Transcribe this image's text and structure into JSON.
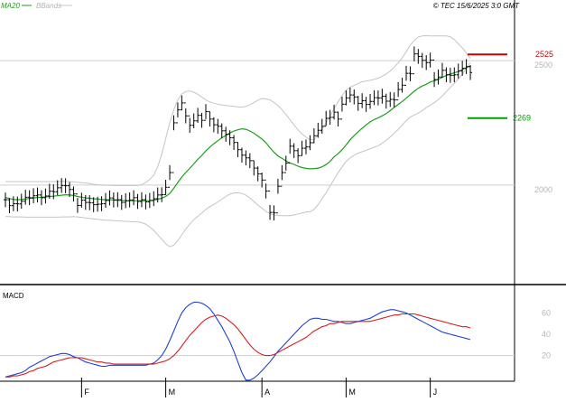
{
  "header": {
    "legend_ma": "MA20",
    "legend_bb": "BBands",
    "copyright": "© TEC 15/6/2025 3:0 GMT"
  },
  "colors": {
    "ma": "#1aa01a",
    "bands": "#c4c4c4",
    "price": "#000000",
    "macd_line": "#1f3fd0",
    "signal_line": "#d21f1f",
    "resistance": "#cc0000",
    "support": "#00a000",
    "grid": "#cfcfcf",
    "axis": "#000000"
  },
  "chart_data": [
    {
      "type": "ohlc",
      "panel": "price",
      "ylim": [
        1600,
        2700
      ],
      "y_ticks": [
        {
          "value": 2000,
          "label": "2000"
        },
        {
          "value": 2500,
          "label": "2500"
        }
      ],
      "gridlines": [
        2000,
        2500
      ],
      "levels": [
        {
          "name": "resistance",
          "value": 2525,
          "label": "2525"
        },
        {
          "name": "support",
          "value": 2269,
          "label": "2269"
        }
      ],
      "x_ticks": [
        {
          "index": 19,
          "label": "F"
        },
        {
          "index": 40,
          "label": "M"
        },
        {
          "index": 64,
          "label": "A"
        },
        {
          "index": 85,
          "label": "M"
        },
        {
          "index": 106,
          "label": "J"
        }
      ],
      "n_bars": 117,
      "close": [
        1941,
        1917,
        1925,
        1924,
        1935,
        1951,
        1949,
        1957,
        1960,
        1949,
        1956,
        1975,
        1973,
        1989,
        1998,
        1997,
        1982,
        1964,
        1918,
        1939,
        1930,
        1929,
        1921,
        1923,
        1925,
        1938,
        1948,
        1940,
        1941,
        1930,
        1937,
        1940,
        1949,
        1934,
        1941,
        1932,
        1938,
        1945,
        1960,
        1961,
        1991,
        2050,
        2250,
        2302,
        2330,
        2278,
        2240,
        2258,
        2280,
        2260,
        2295,
        2265,
        2242,
        2236,
        2218,
        2204,
        2190,
        2171,
        2142,
        2120,
        2109,
        2098,
        2068,
        2045,
        2020,
        1976,
        1890,
        1888,
        1995,
        2050,
        2088,
        2156,
        2138,
        2118,
        2148,
        2153,
        2170,
        2198,
        2220,
        2236,
        2268,
        2272,
        2293,
        2265,
        2325,
        2350,
        2362,
        2354,
        2328,
        2339,
        2324,
        2336,
        2351,
        2350,
        2357,
        2337,
        2344,
        2342,
        2384,
        2401,
        2449,
        2447,
        2527,
        2517,
        2501,
        2492,
        2502,
        2424,
        2434,
        2461,
        2443,
        2441,
        2443,
        2458,
        2469,
        2476,
        2452
      ],
      "ma20": [
        1950,
        1946,
        1942,
        1941,
        1942,
        1944,
        1946,
        1948,
        1950,
        1951,
        1952,
        1954,
        1955,
        1957,
        1959,
        1961,
        1960,
        1958,
        1954,
        1951,
        1948,
        1947,
        1945,
        1944,
        1942,
        1941,
        1941,
        1940,
        1939,
        1938,
        1937,
        1937,
        1937,
        1937,
        1937,
        1937,
        1937,
        1939,
        1943,
        1947,
        1954,
        1966,
        1987,
        2010,
        2032,
        2050,
        2067,
        2085,
        2103,
        2119,
        2137,
        2152,
        2166,
        2178,
        2190,
        2199,
        2209,
        2217,
        2222,
        2226,
        2224,
        2217,
        2208,
        2197,
        2185,
        2170,
        2150,
        2132,
        2117,
        2107,
        2097,
        2089,
        2083,
        2076,
        2070,
        2067,
        2065,
        2066,
        2068,
        2073,
        2082,
        2095,
        2113,
        2126,
        2142,
        2161,
        2182,
        2199,
        2214,
        2228,
        2242,
        2254,
        2263,
        2270,
        2278,
        2287,
        2299,
        2312,
        2324,
        2336,
        2349,
        2363,
        2377,
        2389,
        2398,
        2405,
        2414,
        2419,
        2425,
        2433,
        2440,
        2446,
        2451,
        2456,
        2464,
        2472,
        2478
      ],
      "bb_upper": [
        2014,
        2014,
        2014,
        2014,
        2014,
        2014,
        2014,
        2014,
        2014,
        2014,
        2014,
        2014,
        2014,
        2014,
        2015,
        2014,
        2014,
        2013,
        2011,
        2010,
        2008,
        2006,
        2003,
        2001,
        2000,
        1999,
        1999,
        1998,
        1998,
        1998,
        1998,
        1998,
        1998,
        1998,
        2002,
        2010,
        2022,
        2040,
        2073,
        2124,
        2187,
        2250,
        2302,
        2342,
        2366,
        2376,
        2378,
        2373,
        2365,
        2353,
        2342,
        2334,
        2329,
        2325,
        2322,
        2320,
        2318,
        2316,
        2314,
        2313,
        2316,
        2322,
        2331,
        2341,
        2348,
        2346,
        2342,
        2332,
        2319,
        2303,
        2283,
        2263,
        2242,
        2222,
        2205,
        2192,
        2182,
        2183,
        2202,
        2225,
        2249,
        2278,
        2306,
        2334,
        2360,
        2381,
        2393,
        2401,
        2408,
        2415,
        2418,
        2421,
        2425,
        2429,
        2437,
        2446,
        2458,
        2474,
        2491,
        2512,
        2536,
        2562,
        2581,
        2595,
        2599,
        2600,
        2599,
        2599,
        2599,
        2599,
        2599,
        2596,
        2585,
        2568,
        2551,
        2530,
        2509
      ],
      "bb_lower": [
        1873,
        1873,
        1872,
        1872,
        1872,
        1871,
        1871,
        1871,
        1871,
        1871,
        1871,
        1871,
        1871,
        1871,
        1872,
        1872,
        1872,
        1873,
        1872,
        1870,
        1868,
        1866,
        1864,
        1862,
        1860,
        1859,
        1858,
        1857,
        1856,
        1855,
        1854,
        1853,
        1852,
        1852,
        1849,
        1843,
        1832,
        1818,
        1800,
        1782,
        1764,
        1752,
        1758,
        1776,
        1800,
        1823,
        1843,
        1861,
        1874,
        1887,
        1902,
        1913,
        1922,
        1932,
        1943,
        1954,
        1963,
        1968,
        1969,
        1966,
        1959,
        1948,
        1934,
        1919,
        1907,
        1894,
        1885,
        1880,
        1878,
        1877,
        1877,
        1877,
        1880,
        1884,
        1888,
        1891,
        1893,
        1902,
        1921,
        1945,
        1969,
        1996,
        2023,
        2049,
        2073,
        2095,
        2109,
        2120,
        2128,
        2134,
        2139,
        2146,
        2152,
        2158,
        2168,
        2180,
        2193,
        2208,
        2223,
        2241,
        2259,
        2273,
        2281,
        2289,
        2299,
        2311,
        2321,
        2331,
        2343,
        2358,
        2375,
        2392,
        2408,
        2426,
        2444,
        2469,
        2492
      ],
      "high": [
        1970,
        1947,
        1955,
        1954,
        1965,
        1981,
        1979,
        1987,
        1990,
        1979,
        1986,
        2005,
        2003,
        2019,
        2028,
        2027,
        2012,
        1994,
        1948,
        1969,
        1960,
        1959,
        1951,
        1953,
        1955,
        1968,
        1978,
        1970,
        1971,
        1960,
        1967,
        1970,
        1979,
        1964,
        1971,
        1962,
        1968,
        1975,
        1990,
        1991,
        2021,
        2080,
        2280,
        2332,
        2360,
        2308,
        2270,
        2288,
        2310,
        2290,
        2325,
        2295,
        2272,
        2266,
        2248,
        2234,
        2220,
        2201,
        2172,
        2150,
        2139,
        2128,
        2098,
        2075,
        2050,
        2006,
        1920,
        1918,
        2025,
        2080,
        2118,
        2186,
        2168,
        2148,
        2178,
        2183,
        2200,
        2228,
        2250,
        2266,
        2298,
        2302,
        2323,
        2295,
        2355,
        2380,
        2392,
        2384,
        2358,
        2369,
        2354,
        2366,
        2381,
        2380,
        2387,
        2367,
        2374,
        2372,
        2414,
        2431,
        2479,
        2477,
        2557,
        2547,
        2531,
        2522,
        2532,
        2454,
        2464,
        2491,
        2473,
        2471,
        2473,
        2488,
        2499,
        2506,
        2482
      ],
      "low": [
        1911,
        1887,
        1895,
        1894,
        1905,
        1921,
        1919,
        1927,
        1930,
        1919,
        1926,
        1945,
        1943,
        1959,
        1968,
        1967,
        1952,
        1934,
        1888,
        1909,
        1900,
        1899,
        1891,
        1893,
        1895,
        1908,
        1918,
        1910,
        1911,
        1900,
        1907,
        1910,
        1919,
        1904,
        1911,
        1902,
        1908,
        1915,
        1930,
        1931,
        1961,
        2020,
        2220,
        2272,
        2300,
        2248,
        2210,
        2228,
        2250,
        2230,
        2265,
        2235,
        2212,
        2206,
        2188,
        2174,
        2160,
        2141,
        2112,
        2090,
        2079,
        2068,
        2038,
        2015,
        1990,
        1946,
        1860,
        1858,
        1965,
        2020,
        2058,
        2126,
        2108,
        2088,
        2118,
        2123,
        2140,
        2168,
        2190,
        2206,
        2238,
        2242,
        2263,
        2235,
        2295,
        2320,
        2332,
        2324,
        2298,
        2309,
        2294,
        2306,
        2321,
        2320,
        2327,
        2307,
        2314,
        2312,
        2354,
        2371,
        2419,
        2417,
        2497,
        2487,
        2471,
        2462,
        2472,
        2394,
        2404,
        2431,
        2413,
        2411,
        2413,
        2428,
        2439,
        2446,
        2422
      ]
    },
    {
      "type": "line",
      "panel": "macd",
      "title": "MACD",
      "ylim": [
        -4,
        84
      ],
      "y_ticks": [
        {
          "value": 20,
          "label": "20"
        },
        {
          "value": 40,
          "label": "40"
        },
        {
          "value": 60,
          "label": "60"
        }
      ],
      "series": [
        {
          "color_key": "macd_line",
          "values": [
            0,
            1,
            2,
            3,
            4,
            6,
            9,
            11,
            13,
            15,
            17,
            19,
            20,
            21,
            22,
            22,
            21,
            19,
            18,
            16,
            14,
            13,
            12,
            11,
            10,
            10,
            11,
            11,
            11,
            11,
            11,
            11,
            11,
            11,
            11,
            11,
            12,
            13,
            16,
            20,
            26,
            34,
            43,
            52,
            60,
            65,
            68,
            70,
            70,
            69,
            67,
            64,
            59,
            53,
            47,
            40,
            33,
            24,
            14,
            4,
            -3,
            -3,
            -1,
            2,
            6,
            10,
            14,
            19,
            24,
            28,
            32,
            36,
            40,
            44,
            48,
            51,
            54,
            55,
            55,
            54,
            54,
            53,
            52,
            52,
            51,
            50,
            50,
            51,
            52,
            53,
            54,
            55,
            57,
            59,
            61,
            62,
            63,
            63,
            62,
            61,
            60,
            58,
            56,
            54,
            52,
            50,
            48,
            46,
            44,
            42,
            41,
            40,
            39,
            38,
            37,
            36,
            35
          ]
        },
        {
          "color_key": "signal_line",
          "values": [
            0,
            0,
            1,
            1,
            2,
            3,
            5,
            6,
            8,
            9,
            10,
            12,
            14,
            15,
            16,
            17,
            18,
            18,
            18,
            18,
            17,
            16,
            15,
            14,
            14,
            13,
            13,
            12,
            12,
            12,
            12,
            12,
            12,
            12,
            12,
            12,
            12,
            12,
            13,
            14,
            15,
            17,
            20,
            24,
            29,
            34,
            39,
            43,
            47,
            51,
            54,
            56,
            57,
            58,
            57,
            55,
            52,
            49,
            45,
            40,
            35,
            30,
            26,
            23,
            21,
            20,
            20,
            21,
            23,
            25,
            27,
            29,
            31,
            33,
            35,
            37,
            40,
            43,
            45,
            47,
            48,
            50,
            50,
            51,
            52,
            52,
            52,
            52,
            52,
            52,
            52,
            52,
            53,
            54,
            55,
            56,
            57,
            58,
            58,
            59,
            59,
            59,
            59,
            58,
            57,
            56,
            55,
            54,
            53,
            52,
            51,
            50,
            49,
            48,
            47,
            47,
            46
          ]
        }
      ]
    }
  ]
}
